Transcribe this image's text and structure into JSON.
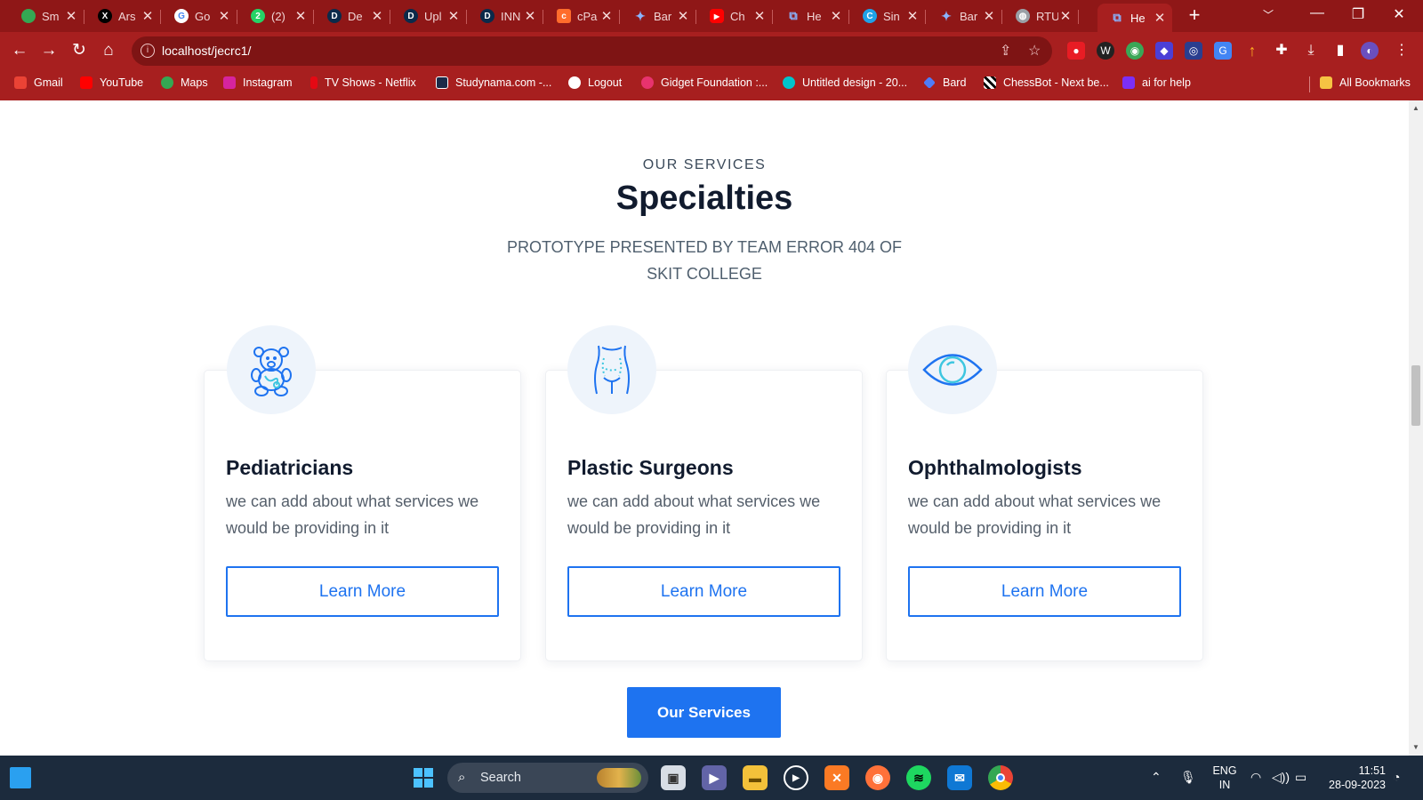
{
  "browser": {
    "tabs": [
      {
        "title": "Sm",
        "icon": "maps-icon",
        "color": "#34a853"
      },
      {
        "title": "Ars",
        "icon": "x-icon",
        "color": "#000000"
      },
      {
        "title": "Go",
        "icon": "google-icon",
        "color": "#ffffff"
      },
      {
        "title": "(2)",
        "icon": "whatsapp-icon",
        "color": "#25d366"
      },
      {
        "title": "De",
        "icon": "d-icon",
        "color": "#0b2a4a"
      },
      {
        "title": "Upl",
        "icon": "d-icon",
        "color": "#0b2a4a"
      },
      {
        "title": "INN",
        "icon": "d-icon",
        "color": "#0b2a4a"
      },
      {
        "title": "cPa",
        "icon": "cpanel-icon",
        "color": "#ff6c2c"
      },
      {
        "title": "Bar",
        "icon": "bard-icon",
        "color": "#4f7cf7"
      },
      {
        "title": "Ch",
        "icon": "youtube-icon",
        "color": "#ff0000"
      },
      {
        "title": "He",
        "icon": "link-icon",
        "color": "#4f7cf7"
      },
      {
        "title": "Sin",
        "icon": "c-icon",
        "color": "#1fa1e8"
      },
      {
        "title": "Bar",
        "icon": "bard-icon",
        "color": "#4f7cf7"
      },
      {
        "title": "RTU",
        "icon": "globe-icon",
        "color": "#9aa0a6"
      },
      {
        "title": "He",
        "icon": "link-icon",
        "color": "#4f7cf7"
      }
    ],
    "url": "localhost/jecrc1/",
    "bookmarks": [
      {
        "label": "Gmail",
        "color": "#ea4335"
      },
      {
        "label": "YouTube",
        "color": "#ff0000"
      },
      {
        "label": "Maps",
        "color": "#34a853"
      },
      {
        "label": "Instagram",
        "color": "#d6249f"
      },
      {
        "label": "TV Shows - Netflix",
        "color": "#e50914"
      },
      {
        "label": "Studynama.com -...",
        "color": "#1b2a48"
      },
      {
        "label": "Logout",
        "color": "#ffffff"
      },
      {
        "label": "Gidget Foundation :...",
        "color": "#e8336e"
      },
      {
        "label": "Untitled design - 20...",
        "color": "#00c4cc"
      },
      {
        "label": "Bard",
        "color": "#4f7cf7"
      },
      {
        "label": "ChessBot - Next be...",
        "color": "#ffffff"
      },
      {
        "label": "ai for help",
        "color": "#7b2ff7"
      }
    ],
    "all_bookmarks": "All Bookmarks"
  },
  "section": {
    "eyebrow": "OUR SERVICES",
    "title": "Specialties",
    "subtitle_line1": "PROTOTYPE PRESENTED BY TEAM ERROR 404 OF",
    "subtitle_line2": "SKIT COLLEGE"
  },
  "cards": [
    {
      "title": "Pediatricians",
      "text": "we can add about what services we would be providing in it",
      "button": "Learn More",
      "icon": "teddy-bear-icon"
    },
    {
      "title": "Plastic Surgeons",
      "text": "we can add about what services we would be providing in it",
      "button": "Learn More",
      "icon": "torso-icon"
    },
    {
      "title": "Ophthalmologists",
      "text": "we can add about what services we would be providing in it",
      "button": "Learn More",
      "icon": "eye-icon"
    }
  ],
  "services_button": "Our Services",
  "taskbar": {
    "search": "Search",
    "lang1": "ENG",
    "lang2": "IN",
    "time": "11:51",
    "date": "28-09-2023"
  },
  "colors": {
    "accent": "#1e73f0",
    "chrome": "#a71f1f",
    "heading": "#111b2e"
  }
}
